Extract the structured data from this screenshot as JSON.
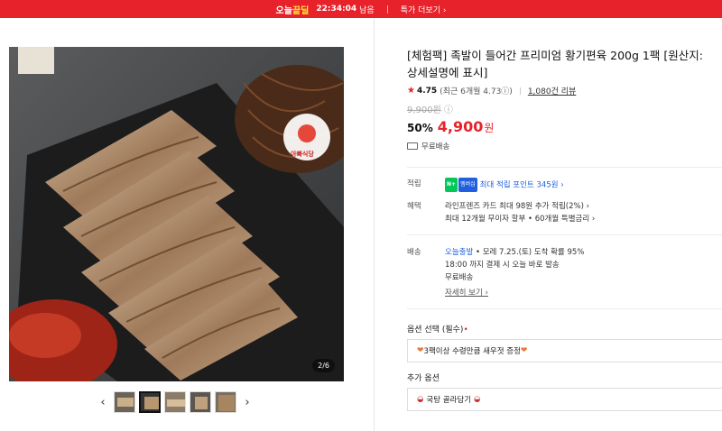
{
  "banner": {
    "brand_a": "오늘",
    "brand_b": "끝딜",
    "timer": "22:34:04",
    "remain_label": "남음",
    "more_label": "특가 더보기",
    "more_arrow": "›"
  },
  "gallery": {
    "badge_text": "아빠식당",
    "counter": "2/6",
    "prev_arrow": "‹",
    "next_arrow": "›",
    "thumb_count": 5,
    "active_thumb": 1
  },
  "product": {
    "title_line1": "[체험팩] 족발이 들어간 프리미엄 황기편육 200g 1팩 [원산지:",
    "title_line2": "상세설명에 표시]",
    "rating": "4.75",
    "rating_recent": "(최근 6개월 4.73ⓘ)",
    "review_link": "1,080건 리뷰",
    "original_price": "9,900원",
    "original_price_info": "ⓘ",
    "discount": "50%",
    "price": "4,900",
    "currency": "원",
    "shipping": "무료배송"
  },
  "benefits": {
    "points_key": "적립",
    "npay_label": "N+",
    "npay_membership": "멤버십",
    "points_text": "최대 적립 포인트 345원",
    "points_arrow": "›",
    "benefit_key": "혜택",
    "benefit_line1": "라인프렌즈 카드 최대 98원 추가 적립(2%)",
    "benefit_line2": "최대 12개월 무이자 할부 • 60개월 특별금리",
    "arrow": "›"
  },
  "delivery": {
    "key": "배송",
    "today_label": "오늘출발",
    "date_text": " • 모레 7.25.(토) 도착 확률 95%",
    "cutoff": "18:00 까지 결제 시 오늘 바로 발송",
    "free": "무료배송",
    "detail_link": "자세히 보기",
    "detail_arrow": "›"
  },
  "options": {
    "required_label": "옵션 선택 (필수)",
    "required_mark": "•",
    "required_value": "3팩이상 수령만큼 새우젓 증정",
    "extra_label": "추가 옵션",
    "extra_value": "국탕 골라담기"
  },
  "colors": {
    "brand_red": "#e8222a",
    "link_blue": "#2060e0",
    "npay_green": "#03c75a"
  }
}
